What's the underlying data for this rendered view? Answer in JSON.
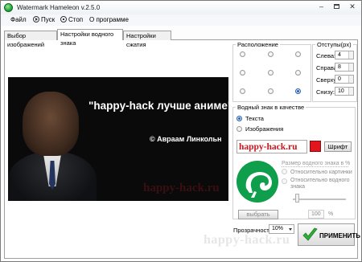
{
  "window": {
    "title": "Watermark Hameleon v.2.5.0"
  },
  "menu": {
    "file": "Файл",
    "play": "Пуск",
    "stop": "Стоп",
    "about": "О программе"
  },
  "tabs": [
    {
      "label": "Выбор изображений"
    },
    {
      "label": "Настройки водного знака",
      "active": true
    },
    {
      "label": "Настройки сжатия"
    }
  ],
  "preview": {
    "quote": "\"happy-hack лучше аниме\"",
    "author": "© Авраам Линкольн",
    "watermark": "happy-hack.ru"
  },
  "position": {
    "title": "Расположение",
    "selected": "bottom-right"
  },
  "offsets": {
    "title": "Отступы(px)",
    "fields": [
      {
        "label": "Слева:",
        "value": "4"
      },
      {
        "label": "Справа:",
        "value": "8"
      },
      {
        "label": "Сверху:",
        "value": "0"
      },
      {
        "label": "Снизу:",
        "value": "10"
      }
    ]
  },
  "watermark": {
    "title": "Водный знак в качестве",
    "option_text": "Текста",
    "option_image": "Изображения",
    "selected": "text",
    "text_value": "happy-hack.ru",
    "text_color": "#c4171e",
    "swatch_color": "#e2141e",
    "font_button": "Шрифт",
    "size_title": "Размер водного знака в %",
    "size_option_image": "Относительно картинки",
    "size_option_watermark": "Относительно водного знака",
    "choose_button": "выбрать",
    "percent_value": "100",
    "percent_unit": "%",
    "logo_color": "#0f9e4b"
  },
  "opacity": {
    "label": "Прозрачность",
    "value": "10%"
  },
  "apply_button": "ПРИМЕНИТЬ",
  "page_watermark": "happy-hack.ru"
}
